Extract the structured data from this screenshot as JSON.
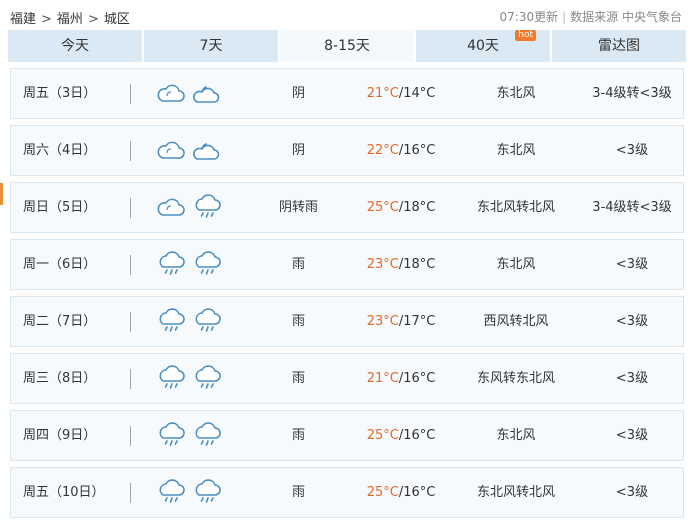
{
  "breadcrumb": [
    "福建",
    "福州",
    "城区"
  ],
  "breadcrumb_sep": ">",
  "meta": {
    "update": "07:30更新",
    "source": "数据来源 中央气象台"
  },
  "tabs": [
    {
      "label": "今天",
      "active": false
    },
    {
      "label": "7天",
      "active": false
    },
    {
      "label": "8-15天",
      "active": true
    },
    {
      "label": "40天",
      "active": false,
      "badge": "hot"
    },
    {
      "label": "雷达图",
      "active": false
    }
  ],
  "colors": {
    "tab_bg": "#dbe9f5",
    "tab_active": "#f4f9fd",
    "high_temp": "#e06a2a",
    "badge": "#f07b2e",
    "icon": "#4a8fc4"
  },
  "forecast": [
    {
      "date": "周五（3日）",
      "icons": [
        "cloudy-icon",
        "partly-cloudy-night-icon"
      ],
      "cond": "阴",
      "high": "21°C",
      "low": "/14°C",
      "wind": "东北风",
      "level": "3-4级转<3级"
    },
    {
      "date": "周六（4日）",
      "icons": [
        "cloudy-icon",
        "partly-cloudy-night-icon"
      ],
      "cond": "阴",
      "high": "22°C",
      "low": "/16°C",
      "wind": "东北风",
      "level": "<3级"
    },
    {
      "date": "周日（5日）",
      "icons": [
        "cloudy-icon",
        "rain-icon"
      ],
      "cond": "阴转雨",
      "high": "25°C",
      "low": "/18°C",
      "wind": "东北风转北风",
      "level": "3-4级转<3级"
    },
    {
      "date": "周一（6日）",
      "icons": [
        "rain-icon",
        "rain-icon"
      ],
      "cond": "雨",
      "high": "23°C",
      "low": "/18°C",
      "wind": "东北风",
      "level": "<3级"
    },
    {
      "date": "周二（7日）",
      "icons": [
        "rain-icon",
        "rain-icon"
      ],
      "cond": "雨",
      "high": "23°C",
      "low": "/17°C",
      "wind": "西风转北风",
      "level": "<3级"
    },
    {
      "date": "周三（8日）",
      "icons": [
        "rain-icon",
        "rain-icon"
      ],
      "cond": "雨",
      "high": "21°C",
      "low": "/16°C",
      "wind": "东风转东北风",
      "level": "<3级"
    },
    {
      "date": "周四（9日）",
      "icons": [
        "rain-icon",
        "rain-icon"
      ],
      "cond": "雨",
      "high": "25°C",
      "low": "/16°C",
      "wind": "东北风",
      "level": "<3级"
    },
    {
      "date": "周五（10日）",
      "icons": [
        "rain-icon",
        "rain-icon"
      ],
      "cond": "雨",
      "high": "25°C",
      "low": "/16°C",
      "wind": "东北风转北风",
      "level": "<3级"
    }
  ]
}
